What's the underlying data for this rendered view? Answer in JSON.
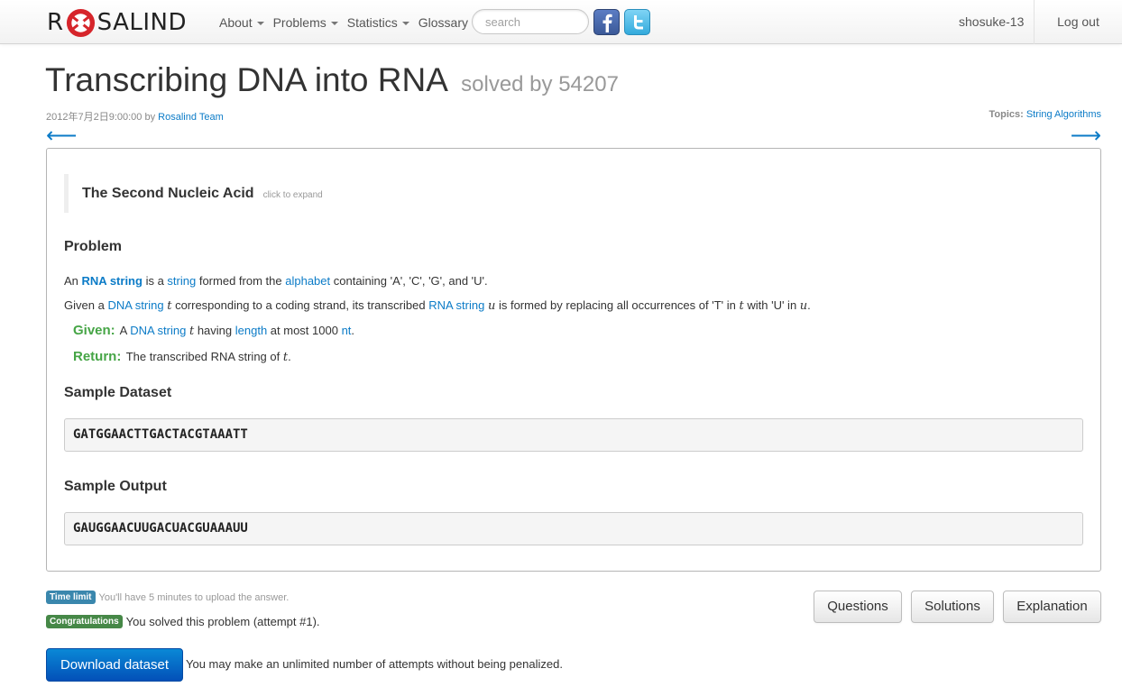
{
  "nav": {
    "brand_left": "R",
    "brand_right": "SALIND",
    "items": [
      {
        "label": "About",
        "dropdown": true
      },
      {
        "label": "Problems",
        "dropdown": true
      },
      {
        "label": "Statistics",
        "dropdown": true
      },
      {
        "label": "Glossary",
        "dropdown": false
      }
    ],
    "search_placeholder": "search",
    "username": "shosuke-13",
    "logout": "Log out"
  },
  "problem": {
    "title": "Transcribing DNA into RNA",
    "solved_by": "solved by 54207",
    "date": "2012年7月2日9:00:00",
    "by_text": "by",
    "author": "Rosalind Team",
    "topics_label": "Topics:",
    "topics_value": "String Algorithms",
    "prev_arrow": "⟵",
    "next_arrow": "⟶"
  },
  "story": {
    "heading": "The Second Nucleic Acid",
    "expand": "click to expand"
  },
  "sections": {
    "problem": "Problem",
    "sample_dataset": "Sample Dataset",
    "sample_output": "Sample Output"
  },
  "text": {
    "p1_a": "An",
    "p1_link_rna": "RNA string",
    "p1_b": "is a",
    "p1_link_string": "string",
    "p1_c": "formed from the",
    "p1_link_alphabet": "alphabet",
    "p1_d": "containing 'A', 'C', 'G', and 'U'.",
    "p2_a": "Given a",
    "p2_link_dna": "DNA string",
    "var_t": "t",
    "var_u": "u",
    "p2_b": "corresponding to a coding strand, its transcribed",
    "p2_link_rna": "RNA string",
    "p2_c": "is formed by replacing all occurrences of 'T' in",
    "p2_d": "with 'U' in",
    "p2_e": ".",
    "given_label": "Given:",
    "given_a": "A",
    "given_link_dna": "DNA string",
    "given_b": "having",
    "given_link_length": "length",
    "given_c": "at most 1000",
    "given_link_nt": "nt",
    "given_d": ".",
    "return_label": "Return:",
    "return_a": "The transcribed RNA string of",
    "return_b": "."
  },
  "samples": {
    "dataset": "GATGGAACTTGACTACGTAAATT",
    "output": "GAUGGAACUUGACUACGUAAAUU"
  },
  "footer": {
    "time_limit_label": "Time limit",
    "time_limit_text": "You'll have 5 minutes to upload the answer.",
    "congrats_label": "Congratulations",
    "congrats_text": "You solved this problem (attempt #1).",
    "buttons": {
      "questions": "Questions",
      "solutions": "Solutions",
      "explanation": "Explanation"
    },
    "download": "Download dataset",
    "download_note": "You may make an unlimited number of attempts without being penalized."
  },
  "colors": {
    "link": "#0b7bc7",
    "given_return": "#46a546",
    "download_button": "#0567c8",
    "info_label": "#3a87ad",
    "success_label": "#468847"
  }
}
